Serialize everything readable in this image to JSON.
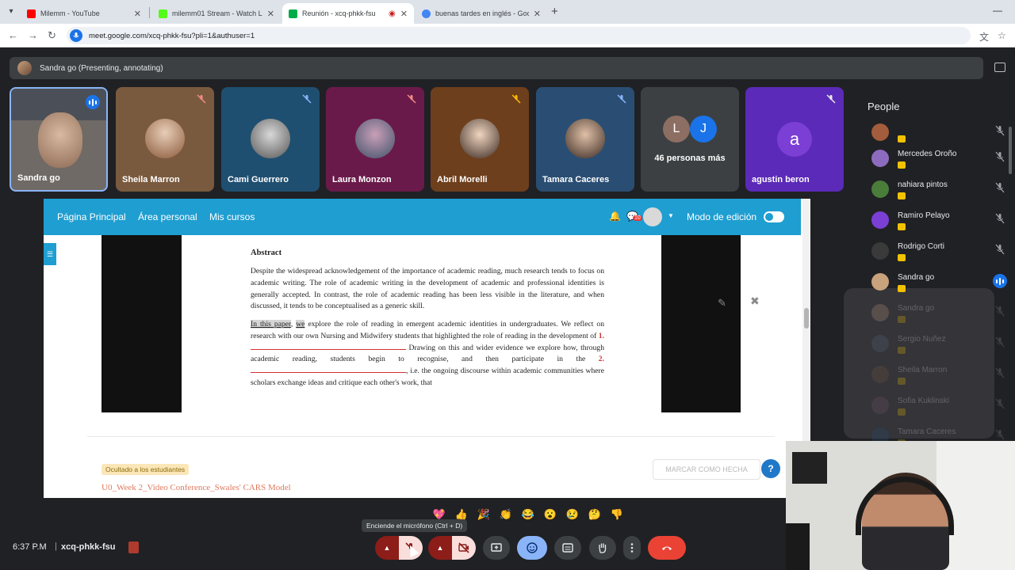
{
  "browser": {
    "tabs": [
      {
        "title": "Milemm - YouTube",
        "color": "#ff0000",
        "active": false
      },
      {
        "title": "milemm01 Stream - Watch Live",
        "color": "#53fc18",
        "active": false
      },
      {
        "title": "Reunión - xcq-phkk-fsu",
        "color": "#00ac47",
        "active": true
      },
      {
        "title": "buenas tardes en inglés - Goog",
        "color": "#4285f4",
        "active": false
      }
    ],
    "url": "meet.google.com/xcq-phkk-fsu?pli=1&authuser=1"
  },
  "meet": {
    "presenting_label": "Sandra go (Presenting, annotating)",
    "tiles": [
      {
        "name": "Sandra go",
        "bg": "#6f6a66"
      },
      {
        "name": "Sheila Marron",
        "bg": "#7a5a3e"
      },
      {
        "name": "Cami Guerrero",
        "bg": "#1f4f70"
      },
      {
        "name": "Laura Monzon",
        "bg": "#6a1a4a"
      },
      {
        "name": "Abril Morelli",
        "bg": "#6e3f1c"
      },
      {
        "name": "Tamara Caceres",
        "bg": "#2a4e73"
      }
    ],
    "more": {
      "initials": [
        "L",
        "J"
      ],
      "label": "46 personas más"
    },
    "last_tile": {
      "initial": "a",
      "name": "agustin beron"
    },
    "people_title": "People",
    "people": [
      {
        "name": "",
        "color": "#a35c3c"
      },
      {
        "name": "Mercedes Oroño",
        "color": "#8d6cc0"
      },
      {
        "name": "nahiara pintos",
        "color": "#4a7d3a"
      },
      {
        "name": "Ramiro Pelayo",
        "color": "#7b3fd6"
      },
      {
        "name": "Rodrigo Corti",
        "color": "#3a3a3a"
      },
      {
        "name": "Sandra go",
        "color": "#c8a27c"
      },
      {
        "name": "Sandra go",
        "color": "#c8a27c"
      },
      {
        "name": "Sergio Nuñez",
        "color": "#5a6a7a"
      },
      {
        "name": "Sheila Marron",
        "color": "#7a5a3e"
      },
      {
        "name": "Sofia Kuklinski",
        "color": "#7a5a6a"
      },
      {
        "name": "Tamara Caceres",
        "color": "#2a4e73"
      }
    ],
    "reactions": [
      "💖",
      "👍",
      "🎉",
      "👏",
      "😂",
      "😮",
      "😢",
      "🤔",
      "👎"
    ],
    "tooltip": "Enciende el micrófono (Ctrl + D)",
    "clock": "6:37 P.M",
    "separator": "|",
    "meeting_code": "xcq-phkk-fsu"
  },
  "moodle": {
    "nav": [
      "Página Principal",
      "Área personal",
      "Mis cursos"
    ],
    "notif_count": "10",
    "edit_mode_label": "Modo de edición",
    "pdf": {
      "heading": "Abstract",
      "p1": "Despite the widespread acknowledgement of the importance of academic reading, much research tends to focus on academic writing. The role of academic writing in the development of academic and professional identities is generally accepted. In contrast, the role of academic reading has been less visible in the literature, and when discussed, it tends to be conceptualised as a generic skill.",
      "p2_hl1": "In this paper",
      "p2_sep": ", ",
      "p2_hl2": "we",
      "p2_a": " explore the role of reading in emergent academic identities in undergraduates. We reflect on research with our own Nursing and Midwifery students that highlighted the role of reading in the development of ",
      "blank1_num": "1.",
      "p2_b": " Drawing on this and wider evidence we explore how, through academic reading, students begin to recognise, and then participate in the ",
      "blank2_num": "2.",
      "p2_c": ", i.e. the ongoing discourse within academic communities where scholars exchange ideas and critique each other's work, that"
    },
    "hidden_badge": "Ocultado a los estudiantes",
    "activity_title": "U0_Week 2_Video Conference_Swales' CARS Model",
    "mark_done": "MARCAR COMO HECHA",
    "help": "?"
  }
}
